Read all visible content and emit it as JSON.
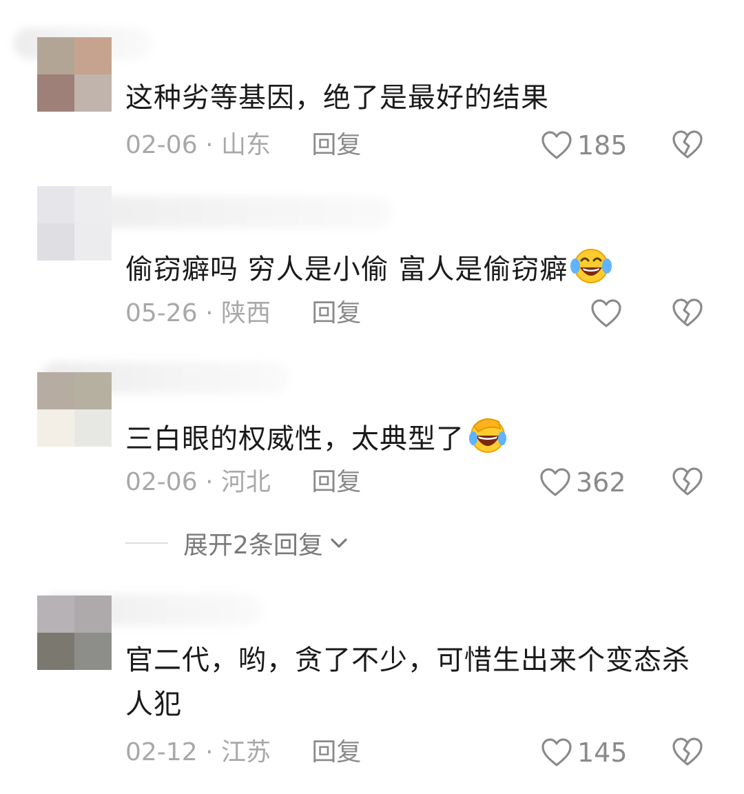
{
  "comments": [
    {
      "avatar": [
        "#b3a596",
        "#c6a38e",
        "#9e8078",
        "#c0b4ac"
      ],
      "text": "这种劣等基因，绝了是最好的结果",
      "date": "02-06",
      "location": "山东",
      "reply": "回复",
      "likes": "185",
      "emoji": ""
    },
    {
      "avatar": [
        "#e6e6ea",
        "#ededf0",
        "#dedee3",
        "#ececef"
      ],
      "text": "偷窃癖吗 穷人是小偷 富人是偷窃癖",
      "date": "05-26",
      "location": "陕西",
      "reply": "回复",
      "likes": "",
      "emoji": "laughing-tears-emoji"
    },
    {
      "avatar": [
        "#b7aca2",
        "#b5b0a0",
        "#f4efe6",
        "#e7e8e3"
      ],
      "text": "三白眼的权威性，太典型了",
      "date": "02-06",
      "location": "河北",
      "reply": "回复",
      "likes": "362",
      "emoji": "facepalm-cry-emoji"
    },
    {
      "avatar": [
        "#b7b2b6",
        "#aeaaab",
        "#7b7870",
        "#8d8d89"
      ],
      "text": "官二代，哟，贪了不少，可惜生出来个变态杀人犯",
      "date": "02-12",
      "location": "江苏",
      "reply": "回复",
      "likes": "145",
      "emoji": ""
    }
  ],
  "expand_replies": "展开2条回复",
  "colors": {
    "text": "#1a1a1a",
    "meta": "#a8a8a8",
    "icon": "#8a8a8a"
  }
}
